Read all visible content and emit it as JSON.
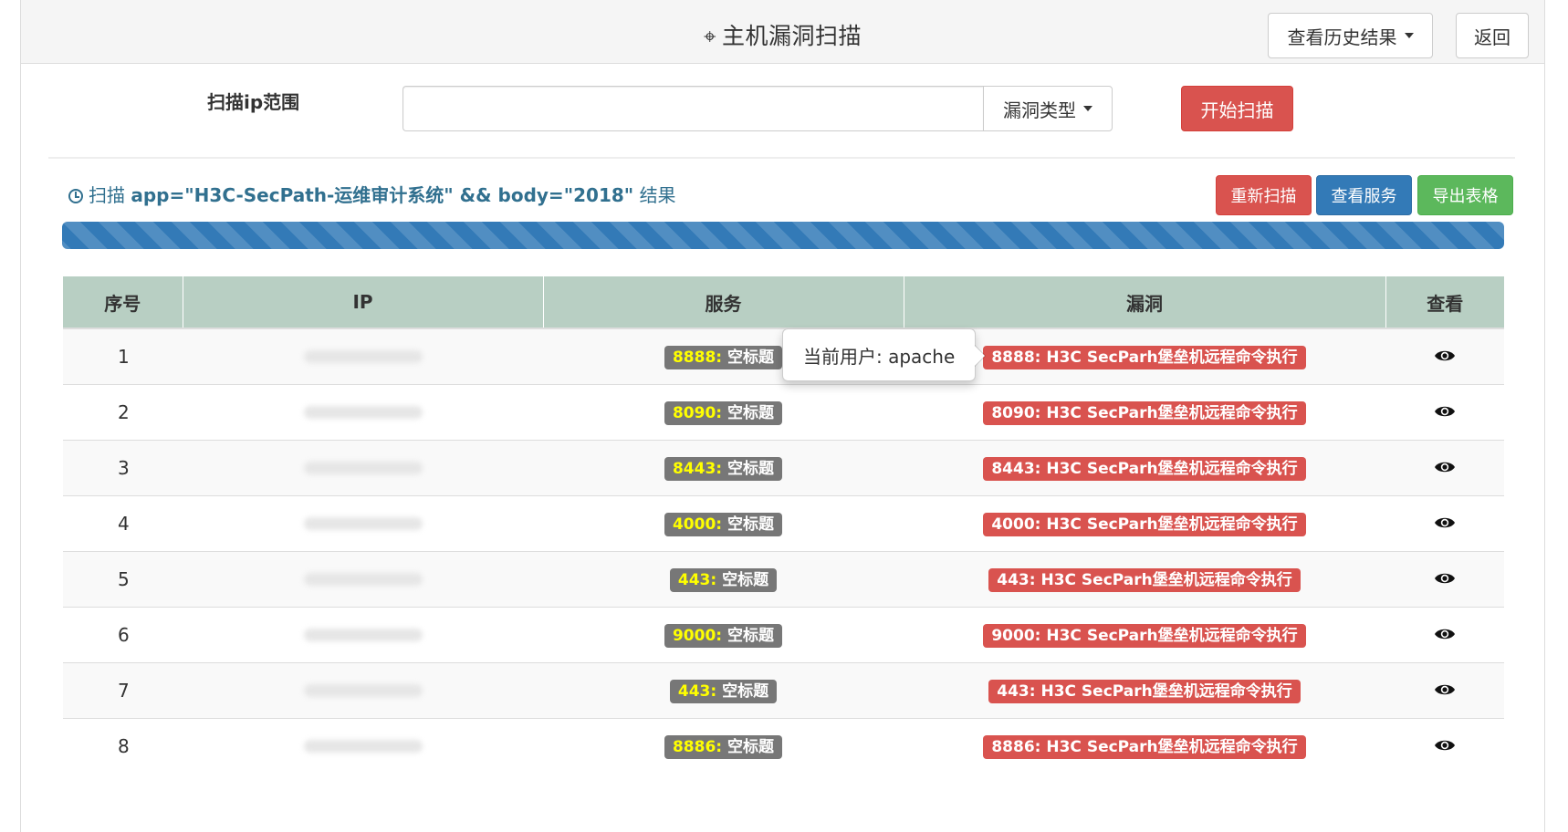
{
  "header": {
    "title": "主机漏洞扫描",
    "history_button": "查看历史结果",
    "back_button": "返回"
  },
  "scan_form": {
    "ip_label": "扫描ip范围",
    "ip_value": "",
    "ip_placeholder": "",
    "vuln_type_button": "漏洞类型",
    "start_button": "开始扫描"
  },
  "result": {
    "prefix": "扫描",
    "query": "app=\"H3C-SecPath-运维审计系统\" && body=\"2018\"",
    "suffix": "结果",
    "rescan_button": "重新扫描",
    "view_services_button": "查看服务",
    "export_button": "导出表格",
    "progress_percent": 100
  },
  "table": {
    "headers": [
      "序号",
      "IP",
      "服务",
      "漏洞",
      "查看"
    ],
    "rows": [
      {
        "index": "1",
        "port": "8888:",
        "service": "空标题",
        "vuln": "8888: H3C SecParh堡垒机远程命令执行"
      },
      {
        "index": "2",
        "port": "8090:",
        "service": "空标题",
        "vuln": "8090: H3C SecParh堡垒机远程命令执行"
      },
      {
        "index": "3",
        "port": "8443:",
        "service": "空标题",
        "vuln": "8443: H3C SecParh堡垒机远程命令执行"
      },
      {
        "index": "4",
        "port": "4000:",
        "service": "空标题",
        "vuln": "4000: H3C SecParh堡垒机远程命令执行"
      },
      {
        "index": "5",
        "port": "443:",
        "service": "空标题",
        "vuln": "443: H3C SecParh堡垒机远程命令执行"
      },
      {
        "index": "6",
        "port": "9000:",
        "service": "空标题",
        "vuln": "9000: H3C SecParh堡垒机远程命令执行"
      },
      {
        "index": "7",
        "port": "443:",
        "service": "空标题",
        "vuln": "443: H3C SecParh堡垒机远程命令执行"
      },
      {
        "index": "8",
        "port": "8886:",
        "service": "空标题",
        "vuln": "8886: H3C SecParh堡垒机远程命令执行"
      }
    ]
  },
  "popover": {
    "text": "当前用户: apache"
  },
  "icons": {
    "title_icon": "crosshair-icon",
    "result_icon": "clock-icon",
    "view_icon": "eye-icon"
  },
  "colors": {
    "danger": "#d9534f",
    "primary": "#337ab7",
    "success": "#5cb85c",
    "table_header": "#b8cfc3",
    "service_label": "#777777",
    "port_text": "#ffff00"
  }
}
